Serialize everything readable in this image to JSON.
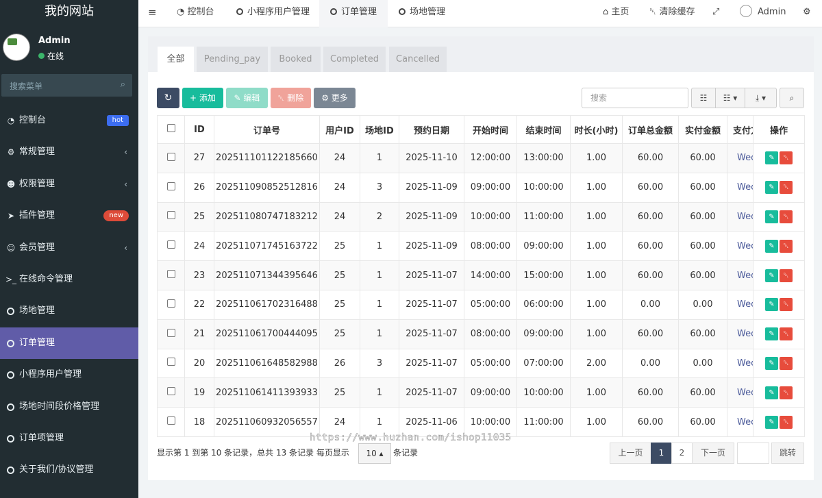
{
  "site_title": "我的网站",
  "user": {
    "name": "Admin",
    "status": "在线"
  },
  "sidebar": {
    "search_placeholder": "搜索菜单",
    "items": [
      {
        "label": "控制台",
        "badge": "hot"
      },
      {
        "label": "常规管理",
        "chevron": "‹"
      },
      {
        "label": "权限管理",
        "chevron": "‹"
      },
      {
        "label": "插件管理",
        "badge": "new"
      },
      {
        "label": "会员管理",
        "chevron": "‹"
      },
      {
        "label": "在线命令管理"
      },
      {
        "label": "场地管理"
      },
      {
        "label": "订单管理"
      },
      {
        "label": "小程序用户管理"
      },
      {
        "label": "场地时间段价格管理"
      },
      {
        "label": "订单项管理"
      },
      {
        "label": "关于我们/协议管理"
      }
    ]
  },
  "topbar": {
    "tabs": [
      "控制台",
      "小程序用户管理",
      "订单管理",
      "场地管理"
    ],
    "home": "主页",
    "clear_cache": "清除缓存",
    "admin": "Admin"
  },
  "tabs": [
    "全部",
    "Pending_pay",
    "Booked",
    "Completed",
    "Cancelled"
  ],
  "toolbar": {
    "add": "添加",
    "edit": "编辑",
    "delete": "删除",
    "more": "更多",
    "search_placeholder": "搜索"
  },
  "table": {
    "columns": [
      "ID",
      "订单号",
      "用户ID",
      "场地ID",
      "预约日期",
      "开始时间",
      "结束时间",
      "时长(小时)",
      "订单总金额",
      "实付金额",
      "支付方式",
      "操作"
    ],
    "rows": [
      [
        "27",
        "202511101122185660",
        "24",
        "1",
        "2025-11-10",
        "12:00:00",
        "13:00:00",
        "1.00",
        "60.00",
        "60.00",
        "Wec"
      ],
      [
        "26",
        "202511090852512816",
        "24",
        "3",
        "2025-11-09",
        "09:00:00",
        "10:00:00",
        "1.00",
        "60.00",
        "60.00",
        "Wec"
      ],
      [
        "25",
        "202511080747183212",
        "24",
        "2",
        "2025-11-09",
        "10:00:00",
        "11:00:00",
        "1.00",
        "60.00",
        "60.00",
        "Wec"
      ],
      [
        "24",
        "202511071745163722",
        "25",
        "1",
        "2025-11-09",
        "08:00:00",
        "09:00:00",
        "1.00",
        "60.00",
        "60.00",
        "Wec"
      ],
      [
        "23",
        "202511071344395646",
        "25",
        "1",
        "2025-11-07",
        "14:00:00",
        "15:00:00",
        "1.00",
        "60.00",
        "60.00",
        "Wec"
      ],
      [
        "22",
        "202511061702316488",
        "25",
        "1",
        "2025-11-07",
        "05:00:00",
        "06:00:00",
        "1.00",
        "0.00",
        "0.00",
        "Wec"
      ],
      [
        "21",
        "202511061700444095",
        "25",
        "1",
        "2025-11-07",
        "08:00:00",
        "09:00:00",
        "1.00",
        "60.00",
        "60.00",
        "Wec"
      ],
      [
        "20",
        "202511061648582988",
        "26",
        "3",
        "2025-11-07",
        "05:00:00",
        "07:00:00",
        "2.00",
        "0.00",
        "0.00",
        "Wec"
      ],
      [
        "19",
        "202511061411393933",
        "25",
        "1",
        "2025-11-07",
        "09:00:00",
        "10:00:00",
        "1.00",
        "60.00",
        "60.00",
        "Wec"
      ],
      [
        "18",
        "202511060932056557",
        "24",
        "1",
        "2025-11-06",
        "10:00:00",
        "11:00:00",
        "1.00",
        "60.00",
        "60.00",
        "Wec"
      ]
    ]
  },
  "footer": {
    "summary": "显示第 1 到第 10 条记录，总共 13 条记录 每页显示",
    "per_page": "10",
    "records_suffix": "条记录"
  },
  "pagination": {
    "prev": "上一页",
    "pages": [
      "1",
      "2"
    ],
    "current": "1",
    "next": "下一页",
    "jump": "跳转"
  },
  "watermark": "https://www.huzhan.com/ishop11035"
}
